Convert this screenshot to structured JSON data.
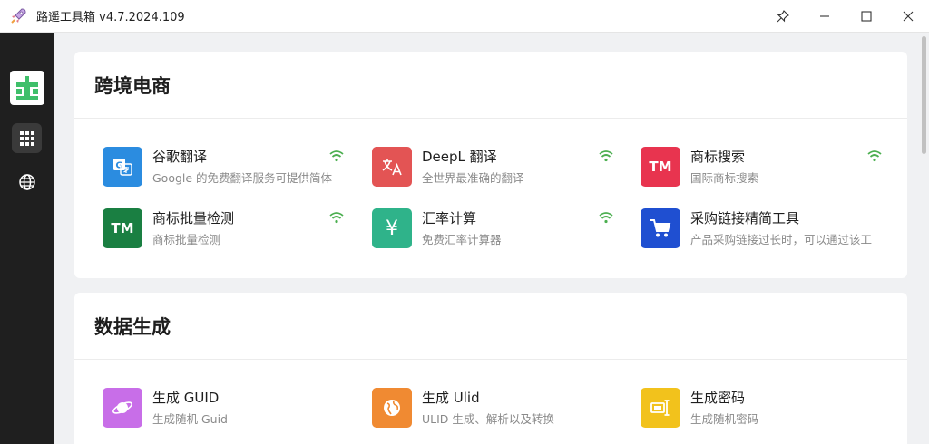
{
  "window": {
    "title": "路遥工具箱 v4.7.2024.109",
    "controls": [
      "pin-icon",
      "minimize-icon",
      "maximize-icon",
      "close-icon"
    ]
  },
  "rail": {
    "logo_icon": "app-logo-icon",
    "items": [
      {
        "icon": "grid-icon",
        "active": true
      },
      {
        "icon": "globe-icon",
        "active": false
      }
    ]
  },
  "sections": [
    {
      "title": "跨境电商",
      "tools": [
        {
          "name": "谷歌翻译",
          "desc": "Google 的免费翻译服务可提供简体",
          "icon": "google-translate-icon",
          "color": "#2b8ce0",
          "online": true
        },
        {
          "name": "DeepL 翻译",
          "desc": "全世界最准确的翻译",
          "icon": "translate-icon",
          "color": "#e35454",
          "online": true
        },
        {
          "name": "商标搜索",
          "desc": "国际商标搜索",
          "icon": "tm-icon",
          "glyph": "TM",
          "color": "#e8344f",
          "online": true
        },
        {
          "name": "商标批量检测",
          "desc": "商标批量检测",
          "icon": "tm-icon",
          "glyph": "TM",
          "color": "#1a7f42",
          "online": true
        },
        {
          "name": "汇率计算",
          "desc": "免费汇率计算器",
          "icon": "yen-icon",
          "glyph": "¥",
          "color": "#2fb38a",
          "online": true
        },
        {
          "name": "采购链接精简工具",
          "desc": "产品采购链接过长时，可以通过该工",
          "icon": "cart-icon",
          "color": "#1f4fd1",
          "online": false
        }
      ]
    },
    {
      "title": "数据生成",
      "tools": [
        {
          "name": "生成 GUID",
          "desc": "生成随机 Guid",
          "icon": "planet-icon",
          "color": "#c86ee8",
          "online": false
        },
        {
          "name": "生成 Ulid",
          "desc": "ULID 生成、解析以及转换",
          "icon": "globe-icon",
          "color": "#f08a32",
          "online": false
        },
        {
          "name": "生成密码",
          "desc": "生成随机密码",
          "icon": "password-icon",
          "color": "#f2c21c",
          "online": false
        }
      ]
    }
  ],
  "colors": {
    "online_indicator": "#4caf50",
    "rail_bg": "#1f1f1f",
    "logo_green": "#3fbf6a"
  }
}
